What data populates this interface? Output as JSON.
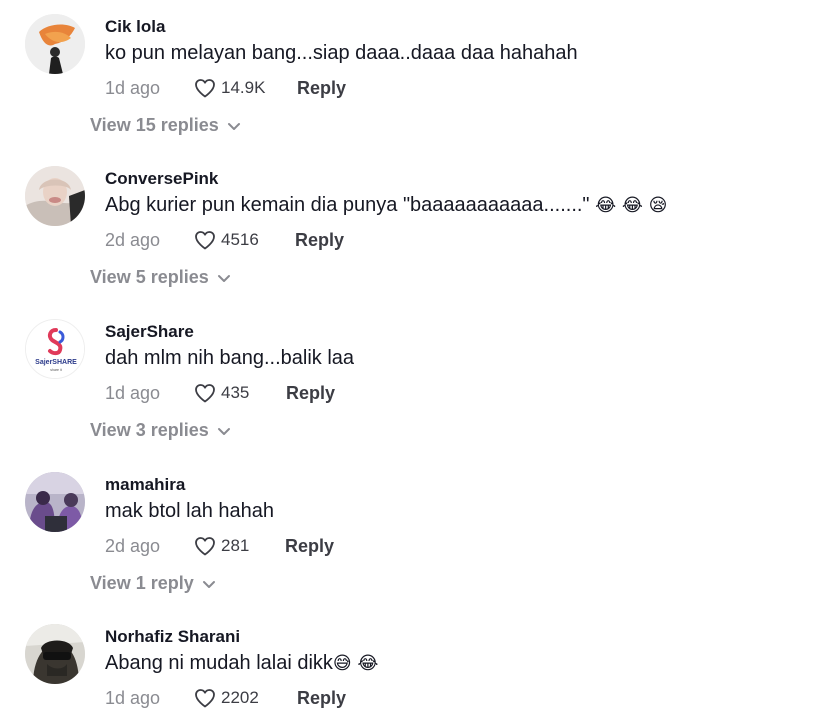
{
  "comments": [
    {
      "username": "Cik lola",
      "text": "ko pun melayan bang...siap daaa..daaa daa hahahah",
      "emojis": "",
      "time": "1d ago",
      "likes": "14.9K",
      "reply_label": "Reply",
      "view_replies": "View 15 replies"
    },
    {
      "username": "ConversePink",
      "text": "Abg kurier pun kemain dia punya \"baaaaaaaaaaa.......\"",
      "emojis": "😂 😂 😪",
      "time": "2d ago",
      "likes": "4516",
      "reply_label": "Reply",
      "view_replies": "View 5 replies"
    },
    {
      "username": "SajerShare",
      "text": "dah mlm nih bang...balik laa",
      "emojis": "",
      "time": "1d ago",
      "likes": "435",
      "reply_label": "Reply",
      "view_replies": "View 3 replies"
    },
    {
      "username": "mamahira",
      "text": "mak btol lah hahah",
      "emojis": "",
      "time": "2d ago",
      "likes": "281",
      "reply_label": "Reply",
      "view_replies": "View 1 reply"
    },
    {
      "username": "Norhafiz Sharani",
      "text": "Abang ni mudah lalai dikk",
      "emojis": "😅 😂",
      "time": "1d ago",
      "likes": "2202",
      "reply_label": "Reply",
      "view_replies": ""
    }
  ],
  "logo_text": "SajerSHARE",
  "colors": {
    "text": "#161823",
    "muted": "#8a8b91",
    "action": "#3c3d44"
  },
  "icons": {
    "like": "heart-outline-icon",
    "expand": "chevron-down-icon"
  }
}
